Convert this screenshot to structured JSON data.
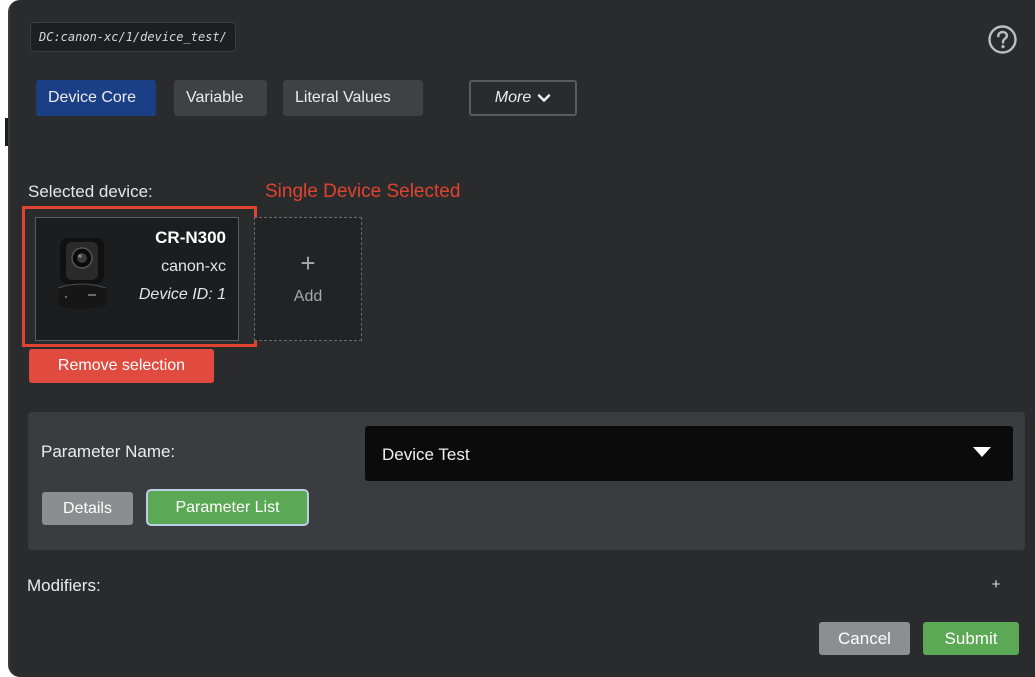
{
  "path": "DC:canon-xc/1/device_test/",
  "tabs": [
    {
      "label": "Device Core",
      "active": true
    },
    {
      "label": "Variable",
      "active": false
    },
    {
      "label": "Literal Values",
      "active": false
    }
  ],
  "more_label": "More",
  "selected_device_label": "Selected device:",
  "annotation": "Single Device Selected",
  "device": {
    "name": "CR-N300",
    "driver": "canon-xc",
    "id_label": "Device ID: 1"
  },
  "add_card": {
    "icon": "+",
    "label": "Add"
  },
  "remove_selection_label": "Remove selection",
  "parameter": {
    "label": "Parameter Name:",
    "value": "Device Test",
    "details_label": "Details",
    "list_label": "Parameter List"
  },
  "modifiers": {
    "label": "Modifiers:",
    "add_icon": "+"
  },
  "actions": {
    "cancel_label": "Cancel",
    "submit_label": "Submit"
  },
  "colors": {
    "panel": "#2a2b2d",
    "active_tab": "#1b3f86",
    "remove": "#e04a3f",
    "submit": "#5ba955",
    "annotation": "#e0432e"
  }
}
